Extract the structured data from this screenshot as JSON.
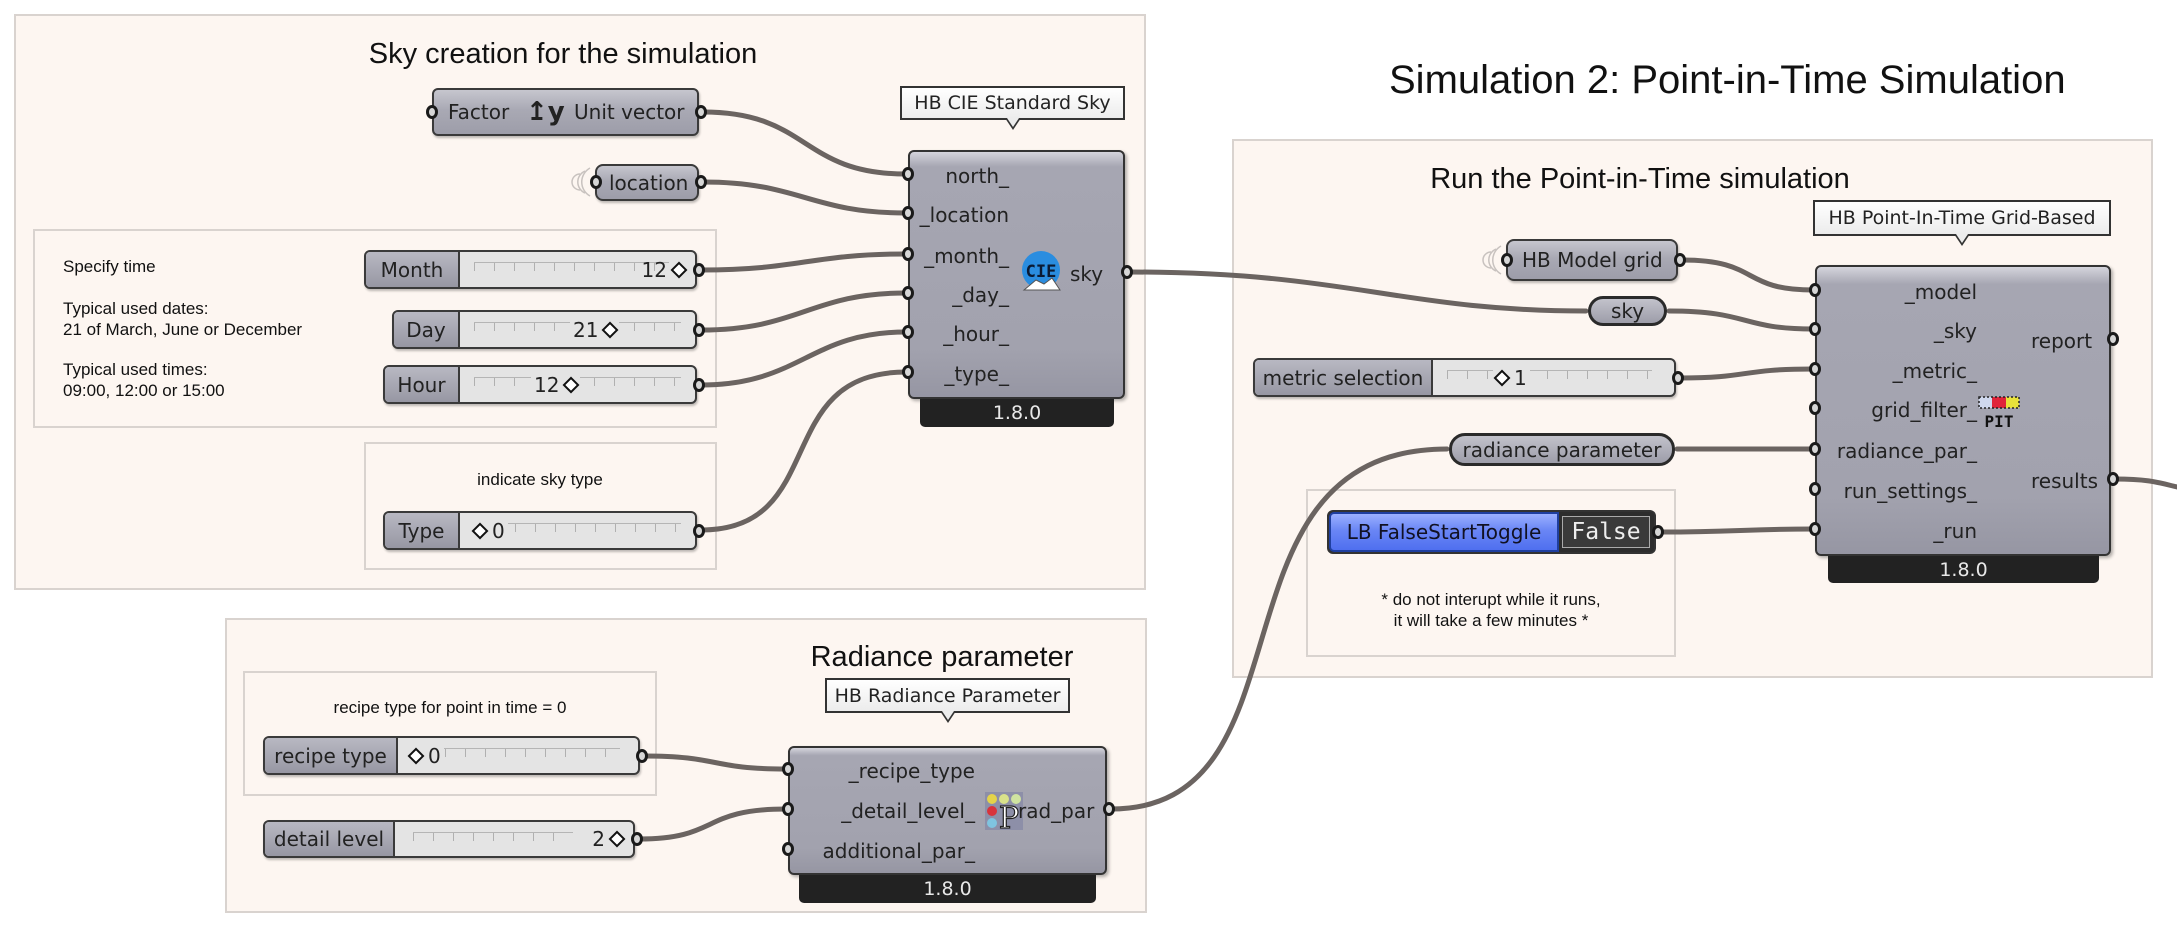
{
  "page_title": "Simulation 2: Point-in-Time Simulation",
  "colors": {
    "canvas": "#ffffff",
    "group_fill": "#fdf6f1",
    "group_border": "#d9d3cf",
    "wire": "#6b6461",
    "toggle_blue": "#5a78f0",
    "version_bar": "#222222"
  },
  "sky_group": {
    "title": "Sky creation for the simulation",
    "vector_node": {
      "input": "Factor",
      "icon": "unit-y-vector-icon",
      "icon_text": "y",
      "output": "Unit vector"
    },
    "location_param": {
      "label": "location"
    },
    "time_group": {
      "notes": [
        "Specify time",
        "Typical used dates:",
        "21 of March, June or December",
        "Typical used times:",
        "09:00, 12:00 or 15:00"
      ],
      "sliders": [
        {
          "name": "Month",
          "value": "12"
        },
        {
          "name": "Day",
          "value": "21"
        },
        {
          "name": "Hour",
          "value": "12"
        }
      ]
    },
    "type_group": {
      "note": "indicate sky type",
      "slider": {
        "name": "Type",
        "value": "0"
      }
    },
    "component": {
      "tooltip": "HB CIE Standard Sky",
      "inputs": [
        "north_",
        "_location",
        "_month_",
        "_day_",
        "_hour_",
        "_type_"
      ],
      "outputs": [
        "sky"
      ],
      "icon": "cie-sky-icon",
      "icon_text": "CIE",
      "version": "1.8.0"
    }
  },
  "run_group": {
    "title": "Run the Point-in-Time simulation",
    "model_param": {
      "label": "HB Model grid"
    },
    "sky_relay": {
      "label": "sky"
    },
    "metric_slider": {
      "name": "metric selection",
      "value": "1"
    },
    "radiance_relay": {
      "label": "radiance parameter"
    },
    "toggle_group": {
      "toggle": {
        "name": "LB FalseStartToggle",
        "value": "False"
      },
      "note_line1": "* do not interupt while it runs,",
      "note_line2": "it will take a few minutes *"
    },
    "component": {
      "tooltip": "HB Point-In-Time Grid-Based",
      "inputs": [
        "_model",
        "_sky",
        "_metric_",
        "grid_filter_",
        "radiance_par_",
        "run_settings_",
        "_run"
      ],
      "outputs": [
        "report",
        "results"
      ],
      "icon": "pit-icon",
      "icon_text": "PIT",
      "version": "1.8.0"
    }
  },
  "radiance_group": {
    "title": "Radiance parameter",
    "recipe_group": {
      "note": "recipe type for point in time = 0",
      "slider": {
        "name": "recipe type",
        "value": "0"
      }
    },
    "detail_slider": {
      "name": "detail level",
      "value": "2"
    },
    "component": {
      "tooltip": "HB Radiance Parameter",
      "inputs": [
        "_recipe_type",
        "_detail_level_",
        "additional_par_"
      ],
      "outputs": [
        "rad_par"
      ],
      "icon": "radiance-parameter-icon",
      "icon_text": "P",
      "version": "1.8.0"
    }
  }
}
